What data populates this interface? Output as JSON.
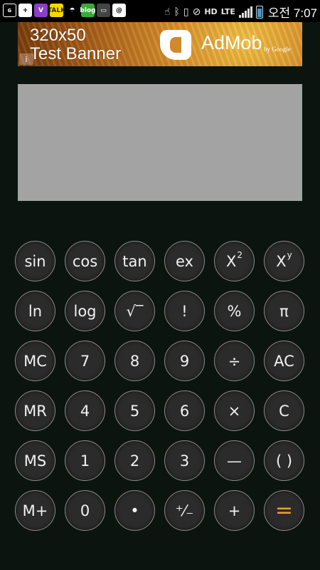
{
  "status_bar": {
    "icons_left": [
      {
        "name": "g-app-icon",
        "glyph": "ɢ",
        "bg": "#000",
        "border": "#fff"
      },
      {
        "name": "plus-icon",
        "glyph": "+",
        "bg": "#fff",
        "color": "#000"
      },
      {
        "name": "v-app-icon",
        "glyph": "V",
        "bg": "#8a3fc8"
      },
      {
        "name": "talk-icon",
        "glyph": "TALK",
        "bg": "#f5d800",
        "color": "#3a2a00"
      },
      {
        "name": "weather-icon",
        "glyph": "☂",
        "bg": "#000"
      },
      {
        "name": "blog-icon",
        "glyph": "blog",
        "bg": "#3aaa35"
      },
      {
        "name": "gallery-icon",
        "glyph": "▭",
        "bg": "#444"
      },
      {
        "name": "at-icon",
        "glyph": "@",
        "bg": "#fff",
        "color": "#000"
      }
    ],
    "network": "LTE",
    "clock": "오전 7:07"
  },
  "ad": {
    "line1": "320x50",
    "line2": "Test Banner",
    "brand": "AdMob",
    "brand_sub": "by Google",
    "info_icon": "i"
  },
  "display": {
    "value": ""
  },
  "keys": [
    {
      "label": "sin",
      "name": "key-sin"
    },
    {
      "label": "cos",
      "name": "key-cos"
    },
    {
      "label": "tan",
      "name": "key-tan"
    },
    {
      "label": "ex",
      "name": "key-ex"
    },
    {
      "label": "X",
      "sup": "2",
      "name": "key-x-squared"
    },
    {
      "label": "X",
      "sup": "y",
      "name": "key-x-power-y"
    },
    {
      "label": "ln",
      "name": "key-ln"
    },
    {
      "label": "log",
      "name": "key-log"
    },
    {
      "label": "√‾",
      "name": "key-sqrt"
    },
    {
      "label": "!",
      "name": "key-factorial"
    },
    {
      "label": "%",
      "name": "key-percent"
    },
    {
      "label": "π",
      "name": "key-pi"
    },
    {
      "label": "MC",
      "name": "key-mc"
    },
    {
      "label": "7",
      "name": "key-7"
    },
    {
      "label": "8",
      "name": "key-8"
    },
    {
      "label": "9",
      "name": "key-9"
    },
    {
      "label": "÷",
      "name": "key-divide"
    },
    {
      "label": "AC",
      "name": "key-ac"
    },
    {
      "label": "MR",
      "name": "key-mr"
    },
    {
      "label": "4",
      "name": "key-4"
    },
    {
      "label": "5",
      "name": "key-5"
    },
    {
      "label": "6",
      "name": "key-6"
    },
    {
      "label": "×",
      "name": "key-multiply"
    },
    {
      "label": "C",
      "name": "key-c"
    },
    {
      "label": "MS",
      "name": "key-ms"
    },
    {
      "label": "1",
      "name": "key-1"
    },
    {
      "label": "2",
      "name": "key-2"
    },
    {
      "label": "3",
      "name": "key-3"
    },
    {
      "label": "—",
      "name": "key-minus"
    },
    {
      "label": "( )",
      "name": "key-parentheses"
    },
    {
      "label": "M+",
      "name": "key-m-plus"
    },
    {
      "label": "0",
      "name": "key-0"
    },
    {
      "label": "•",
      "name": "key-decimal"
    },
    {
      "label": "⁺⁄₋",
      "name": "key-plus-minus"
    },
    {
      "label": "+",
      "name": "key-plus"
    },
    {
      "label": "=",
      "name": "key-equals",
      "accent": "#f0a020"
    }
  ]
}
